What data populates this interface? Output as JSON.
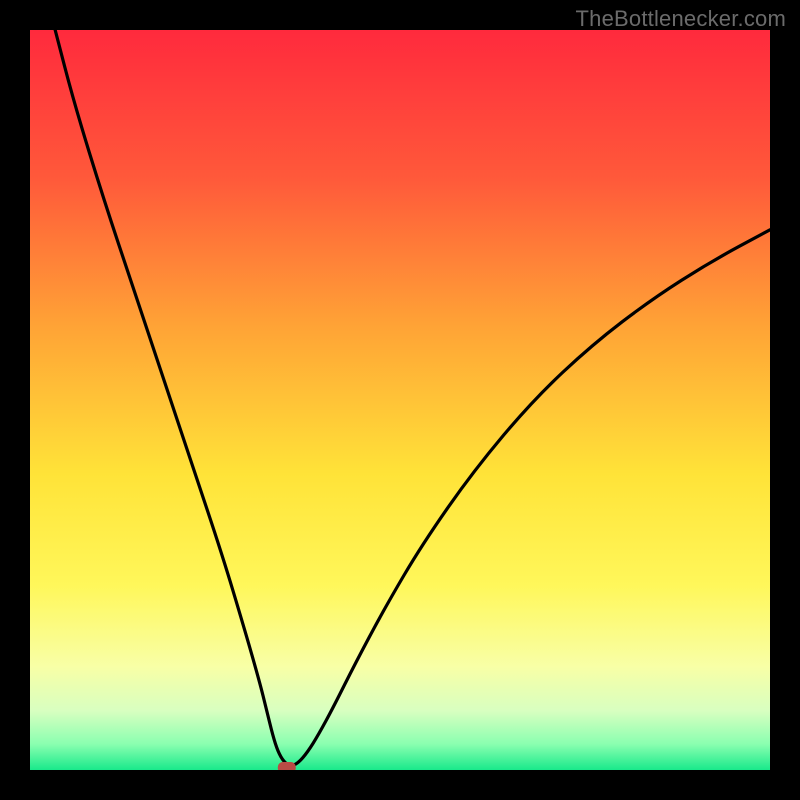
{
  "watermark": "TheBottlenecker.com",
  "chart_data": {
    "type": "line",
    "title": "",
    "xlabel": "",
    "ylabel": "",
    "xlim": [
      0,
      100
    ],
    "ylim": [
      0,
      100
    ],
    "gradient_stops": [
      {
        "offset": 0.0,
        "color": "#ff2a3d"
      },
      {
        "offset": 0.2,
        "color": "#ff593a"
      },
      {
        "offset": 0.4,
        "color": "#ffa336"
      },
      {
        "offset": 0.6,
        "color": "#ffe338"
      },
      {
        "offset": 0.75,
        "color": "#fff75a"
      },
      {
        "offset": 0.86,
        "color": "#f8ffa6"
      },
      {
        "offset": 0.92,
        "color": "#d8ffc0"
      },
      {
        "offset": 0.965,
        "color": "#8affb0"
      },
      {
        "offset": 1.0,
        "color": "#19e98b"
      }
    ],
    "series": [
      {
        "name": "bottleneck-curve",
        "x": [
          3.4,
          6,
          10,
          14,
          18,
          22,
          26,
          29,
          31,
          32,
          32.8,
          33.5,
          34.3,
          35.2,
          36.2,
          37.5,
          39,
          41,
          44,
          48,
          53,
          60,
          68,
          76,
          84,
          92,
          100
        ],
        "values": [
          100,
          90,
          77,
          65,
          53,
          41,
          29,
          19,
          12,
          8,
          4.7,
          2.5,
          1.1,
          0.5,
          0.9,
          2.4,
          4.8,
          8.5,
          14.5,
          22,
          30.5,
          40.5,
          50,
          57.5,
          63.6,
          68.7,
          73
        ]
      }
    ],
    "marker": {
      "x": 34.7,
      "y": 0.0,
      "color": "#b94b45"
    }
  }
}
